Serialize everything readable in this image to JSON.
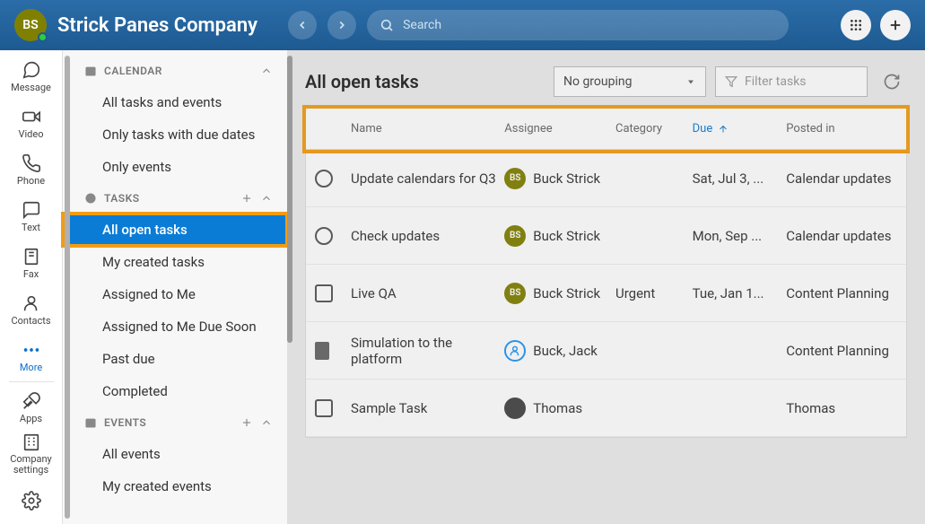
{
  "topbar": {
    "avatar_initials": "BS",
    "title": "Strick Panes Company",
    "search_placeholder": "Search"
  },
  "rail": [
    {
      "icon": "message",
      "label": "Message"
    },
    {
      "icon": "video",
      "label": "Video"
    },
    {
      "icon": "phone",
      "label": "Phone"
    },
    {
      "icon": "text",
      "label": "Text"
    },
    {
      "icon": "fax",
      "label": "Fax"
    },
    {
      "icon": "contacts",
      "label": "Contacts"
    },
    {
      "icon": "more",
      "label": "More",
      "active": true
    },
    {
      "icon": "apps",
      "label": "Apps"
    },
    {
      "icon": "company",
      "label": "Company settings"
    }
  ],
  "sidebar": {
    "calendar_header": "CALENDAR",
    "calendar_items": [
      "All tasks and events",
      "Only tasks with due dates",
      "Only events"
    ],
    "tasks_header": "TASKS",
    "tasks_items": [
      "All open tasks",
      "My created tasks",
      "Assigned to Me",
      "Assigned to Me Due Soon",
      "Past due",
      "Completed"
    ],
    "events_header": "EVENTS",
    "events_items": [
      "All events",
      "My created events"
    ]
  },
  "main": {
    "title": "All open tasks",
    "grouping": "No grouping",
    "filter_placeholder": "Filter tasks",
    "columns": {
      "name": "Name",
      "assignee": "Assignee",
      "category": "Category",
      "due": "Due",
      "posted": "Posted in"
    },
    "rows": [
      {
        "check": "radio",
        "name": "Update calendars for Q3",
        "avatar": "BS",
        "assignee": "Buck Strick",
        "category": "",
        "due": "Sat, Jul 3, ...",
        "posted": "Calendar updates"
      },
      {
        "check": "radio",
        "name": "Check updates",
        "avatar": "BS",
        "assignee": "Buck Strick",
        "category": "",
        "due": "Mon, Sep ...",
        "posted": "Calendar updates"
      },
      {
        "check": "checkbox",
        "name": "Live QA",
        "avatar": "BS",
        "assignee": "Buck Strick",
        "category": "Urgent",
        "due": "Tue, Jan 1...",
        "posted": "Content Planning"
      },
      {
        "check": "solid",
        "name": "Simulation to the platform",
        "avatar": "blue",
        "assignee": "Buck, Jack",
        "category": "",
        "due": "",
        "posted": "Content Planning"
      },
      {
        "check": "checkbox",
        "name": "Sample Task",
        "avatar": "img",
        "assignee": "Thomas",
        "category": "",
        "due": "",
        "posted": "Thomas"
      }
    ]
  }
}
